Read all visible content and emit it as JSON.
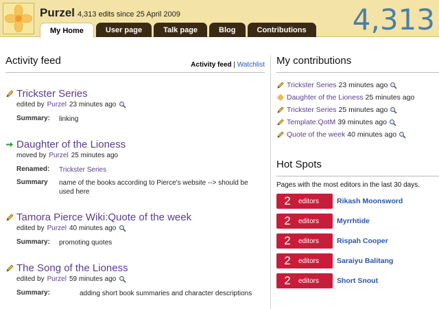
{
  "header": {
    "username": "Purzel",
    "edit_summary": "4,313 edits since 25 April 2009",
    "big_count": "4,313",
    "tabs": [
      {
        "label": "My Home",
        "active": true
      },
      {
        "label": "User page",
        "active": false
      },
      {
        "label": "Talk page",
        "active": false
      },
      {
        "label": "Blog",
        "active": false
      },
      {
        "label": "Contributions",
        "active": false
      }
    ]
  },
  "activity_feed": {
    "title": "Activity feed",
    "link_current": "Activity feed",
    "separator": "|",
    "link_watchlist": "Watchlist",
    "items": [
      {
        "icon": "pencil-icon",
        "title": "Trickster Series",
        "action": "edited by",
        "user": "Purzel",
        "time": "23 minutes ago",
        "rows": [
          {
            "label": "Summary:",
            "value": "linking"
          }
        ]
      },
      {
        "icon": "arrow-right-icon",
        "title": "Daughter of the Lioness",
        "action": "moved by",
        "user": "Purzel",
        "time": "25 minutes ago",
        "rows": [
          {
            "label": "Renamed:",
            "value": "Trickster Series"
          },
          {
            "label": "Summary",
            "value": "name of the books according to Pierce's website --> should be used here"
          }
        ]
      },
      {
        "icon": "pencil-icon",
        "title": "Tamora Pierce Wiki:Quote of the week",
        "action": "edited by",
        "user": "Purzel",
        "time": "40 minutes ago",
        "rows": [
          {
            "label": "Summary:",
            "value": "promoting quotes"
          }
        ]
      },
      {
        "icon": "pencil-icon",
        "title": "The Song of the Lioness",
        "action": "edited by",
        "user": "Purzel",
        "time": "59 minutes ago",
        "rows": [
          {
            "label": "Summary:",
            "value": "adding short book summaries and character descriptions"
          }
        ]
      }
    ]
  },
  "my_contributions": {
    "title": "My contributions",
    "items": [
      {
        "icon": "pencil-icon",
        "page": "Trickster Series",
        "time": "23 minutes ago"
      },
      {
        "icon": "sun-icon",
        "page": "Daughter of the Lioness",
        "time": "25 minutes ago"
      },
      {
        "icon": "pencil-icon",
        "page": "Trickster Series",
        "time": "25 minutes ago"
      },
      {
        "icon": "pencil-icon",
        "page": "Template:QotM",
        "time": "39 minutes ago"
      },
      {
        "icon": "pencil-icon",
        "page": "Quote of the week",
        "time": "40 minutes ago"
      }
    ]
  },
  "hot_spots": {
    "title": "Hot Spots",
    "description": "Pages with the most editors in the last 30 days.",
    "items": [
      {
        "count": "2",
        "unit": "editors",
        "page": "Rikash Moonsword"
      },
      {
        "count": "2",
        "unit": "editors",
        "page": "Myrrhtide"
      },
      {
        "count": "2",
        "unit": "editors",
        "page": "Rispah Cooper"
      },
      {
        "count": "2",
        "unit": "editors",
        "page": "Saraiyu Balitang"
      },
      {
        "count": "2",
        "unit": "editors",
        "page": "Short Snout"
      }
    ]
  },
  "colors": {
    "header_bg": "#f3e3a6",
    "tab_bg": "#3a2a14",
    "link_purple": "#5a3c8c",
    "link_blue": "#2a55a8",
    "badge_red": "#c81d3a",
    "count_blue": "#4a7fa8"
  }
}
